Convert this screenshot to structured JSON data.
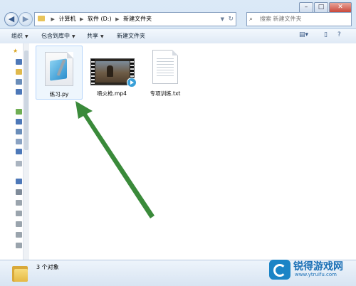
{
  "window": {
    "controls": {
      "minimize": "–",
      "maximize": "□",
      "close": "✕"
    },
    "nav": {
      "back": "◀",
      "forward": "▶"
    },
    "address": {
      "segments": [
        "计算机",
        "软件 (D:)",
        "新建文件夹"
      ],
      "refresh": "↻"
    },
    "search": {
      "placeholder": "搜索 新建文件夹"
    }
  },
  "toolbar": {
    "organize": "组织",
    "include_in_library": "包含到库中",
    "share": "共享",
    "new_folder": "新建文件夹"
  },
  "files": [
    {
      "name": "练习.py",
      "type": "py",
      "selected": true
    },
    {
      "name": "喷火枪.mp4",
      "type": "mp4",
      "selected": false
    },
    {
      "name": "专项训练.txt",
      "type": "txt",
      "selected": false
    }
  ],
  "status": {
    "count": "3 个对象"
  },
  "watermark": {
    "brand": "锐得游戏网",
    "url": "www.ytruifu.com"
  },
  "colors": {
    "arrow": "#3a8a3a",
    "brand": "#1a6fb5"
  }
}
